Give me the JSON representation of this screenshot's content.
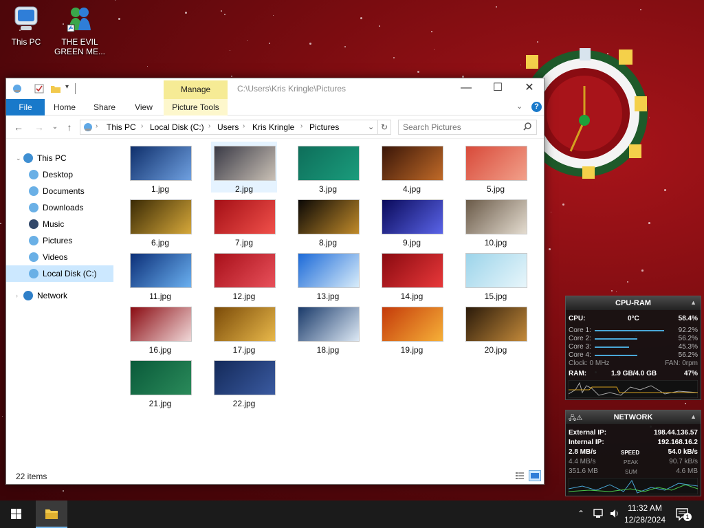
{
  "desktop": {
    "icons": [
      {
        "label": "This PC"
      },
      {
        "label": "THE EVIL GREEN ME..."
      }
    ],
    "clock_widget": {
      "type": "analog christmas clock"
    }
  },
  "window": {
    "title_path": "C:\\Users\\Kris Kringle\\Pictures",
    "manage_label": "Manage",
    "controls": {
      "minimize": "—",
      "maximize": "☐",
      "close": "✕"
    },
    "ribbon_tabs": [
      "File",
      "Home",
      "Share",
      "View",
      "Picture Tools"
    ],
    "breadcrumbs": [
      "This PC",
      "Local Disk (C:)",
      "Users",
      "Kris Kringle",
      "Pictures"
    ],
    "search_placeholder": "Search Pictures",
    "nav": {
      "items": [
        {
          "label": "This PC",
          "icon": "pc-icon",
          "color": "#3f8fd2"
        },
        {
          "label": "Desktop",
          "icon": "desktop-icon",
          "color": "#6ab0e6"
        },
        {
          "label": "Documents",
          "icon": "documents-icon",
          "color": "#6ab0e6"
        },
        {
          "label": "Downloads",
          "icon": "downloads-icon",
          "color": "#6ab0e6"
        },
        {
          "label": "Music",
          "icon": "music-icon",
          "color": "#33496b"
        },
        {
          "label": "Pictures",
          "icon": "pictures-icon",
          "color": "#6ab0e6"
        },
        {
          "label": "Videos",
          "icon": "videos-icon",
          "color": "#6ab0e6"
        },
        {
          "label": "Local Disk (C:)",
          "icon": "disk-icon",
          "color": "#6ab0e6"
        },
        {
          "label": "Network",
          "icon": "network-icon",
          "color": "#2f7fc8"
        }
      ]
    },
    "files": [
      {
        "name": "1.jpg",
        "c1": "#0f2f6b",
        "c2": "#6fa0e0"
      },
      {
        "name": "2.jpg",
        "c1": "#3a3a46",
        "c2": "#c9c0b5"
      },
      {
        "name": "3.jpg",
        "c1": "#0e6e5a",
        "c2": "#1a9c7c"
      },
      {
        "name": "4.jpg",
        "c1": "#3a1608",
        "c2": "#c06a28"
      },
      {
        "name": "5.jpg",
        "c1": "#d84a3a",
        "c2": "#f2a08a"
      },
      {
        "name": "6.jpg",
        "c1": "#3a2a05",
        "c2": "#d6a83a"
      },
      {
        "name": "7.jpg",
        "c1": "#a40f16",
        "c2": "#f0504a"
      },
      {
        "name": "8.jpg",
        "c1": "#0b0806",
        "c2": "#c08a2a"
      },
      {
        "name": "9.jpg",
        "c1": "#0a0a5a",
        "c2": "#5a64e8"
      },
      {
        "name": "10.jpg",
        "c1": "#6a5a48",
        "c2": "#e4dcd0"
      },
      {
        "name": "11.jpg",
        "c1": "#0c2f78",
        "c2": "#6ab0f0"
      },
      {
        "name": "12.jpg",
        "c1": "#a8101a",
        "c2": "#e8505a"
      },
      {
        "name": "13.jpg",
        "c1": "#1c6ad8",
        "c2": "#d8ecfa"
      },
      {
        "name": "14.jpg",
        "c1": "#8a0a10",
        "c2": "#e8383a"
      },
      {
        "name": "15.jpg",
        "c1": "#9cd4ea",
        "c2": "#e8f6fb"
      },
      {
        "name": "16.jpg",
        "c1": "#8a0b12",
        "c2": "#f0d8d8"
      },
      {
        "name": "17.jpg",
        "c1": "#7a4a08",
        "c2": "#e8b84a"
      },
      {
        "name": "18.jpg",
        "c1": "#1a3a6a",
        "c2": "#dce8f4"
      },
      {
        "name": "19.jpg",
        "c1": "#c43a0a",
        "c2": "#f6b038"
      },
      {
        "name": "20.jpg",
        "c1": "#2a1a0a",
        "c2": "#c48a3a"
      },
      {
        "name": "21.jpg",
        "c1": "#0a5a3a",
        "c2": "#2a8a5a"
      },
      {
        "name": "22.jpg",
        "c1": "#142a5a",
        "c2": "#3a5aa0"
      }
    ],
    "items_count": "22 items"
  },
  "gadgets": {
    "cpu_ram": {
      "title": "CPU-RAM",
      "cpu_label": "CPU:",
      "cpu_temp": "0°C",
      "cpu_percent": "58.4%",
      "cores": [
        {
          "label": "Core 1:",
          "value": "92.2%",
          "level": 0.922
        },
        {
          "label": "Core 2:",
          "value": "56.2%",
          "level": 0.562
        },
        {
          "label": "Core 3:",
          "value": "45.3%",
          "level": 0.453
        },
        {
          "label": "Core 4:",
          "value": "56.2%",
          "level": 0.562
        }
      ],
      "clock": "Clock: 0 MHz",
      "fan": "FAN: 0rpm",
      "ram_label": "RAM:",
      "ram_value": "1.9 GB/4.0 GB",
      "ram_percent": "47%"
    },
    "network": {
      "title": "NETWORK",
      "external_label": "External IP:",
      "external_ip": "198.44.136.57",
      "internal_label": "Internal IP:",
      "internal_ip": "192.168.16.2",
      "speed_down": "2.8 MB/s",
      "speed_label": "SPEED",
      "speed_up": "54.0 kB/s",
      "peak_down": "4.4 MB/s",
      "peak_label": "PEAK",
      "peak_up": "90.7 kB/s",
      "sum_down": "351.6 MB",
      "sum_label": "SUM",
      "sum_up": "4.6 MB"
    }
  },
  "taskbar": {
    "time": "11:32 AM",
    "date": "12/28/2024",
    "notification_count": "1"
  }
}
